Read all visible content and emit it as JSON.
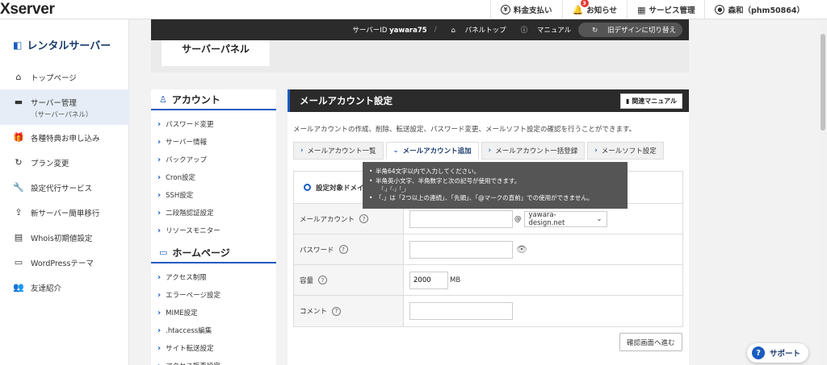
{
  "header": {
    "logo": "Xserver",
    "nav": [
      {
        "icon": "yen-icon",
        "label": "料金支払い"
      },
      {
        "icon": "bell-icon",
        "label": "お知らせ",
        "badge": "3"
      },
      {
        "icon": "grid-icon",
        "label": "サービス管理"
      },
      {
        "icon": "user-icon",
        "label": "森和（phm50864）"
      }
    ]
  },
  "sidebar": {
    "title": "レンタルサーバー",
    "items": [
      {
        "icon": "home-icon",
        "label": "トップページ"
      },
      {
        "icon": "server-icon",
        "label": "サーバー管理",
        "sub": "（サーバーパネル）",
        "active": true
      },
      {
        "icon": "gift-icon",
        "label": "各種特典お申し込み"
      },
      {
        "icon": "refresh-icon",
        "label": "プラン変更"
      },
      {
        "icon": "wrench-icon",
        "label": "設定代行サービス"
      },
      {
        "icon": "upload-icon",
        "label": "新サーバー簡単移行"
      },
      {
        "icon": "doc-icon",
        "label": "Whois初期値設定"
      },
      {
        "icon": "window-icon",
        "label": "WordPressテーマ"
      },
      {
        "icon": "people-icon",
        "label": "友達紹介"
      }
    ]
  },
  "panel": {
    "title": "サーバーパネル",
    "server_id_label": "サーバーID",
    "server_id": "yawara75",
    "panel_top": "パネルトップ",
    "manual": "マニュアル",
    "old_design": "旧デザインに切り替え"
  },
  "submenu": {
    "account_title": "アカウント",
    "account_items": [
      "パスワード変更",
      "サーバー情報",
      "バックアップ",
      "Cron設定",
      "SSH設定",
      "二段階認証設定",
      "リソースモニター"
    ],
    "homepage_title": "ホームページ",
    "homepage_items": [
      "アクセス制限",
      "エラーページ設定",
      "MIME設定",
      ".htaccess編集",
      "サイト転送設定",
      "アクセス拒否設定"
    ]
  },
  "content": {
    "title": "メールアカウント設定",
    "manual_button": "関連マニュアル",
    "description": "メールアカウントの作成、削除、転送設定、パスワード変更、メールソフト設定の確認を行うことができます。",
    "tabs": [
      "メールアカウント一覧",
      "メールアカウント追加",
      "メールアカウント一括登録",
      "メールソフト設定"
    ],
    "active_tab": 1,
    "target_label": "設定対象ドメイ",
    "fields": {
      "account_label": "メールアカウント",
      "account_value": "",
      "at": "@",
      "domain": "yawara-design.net",
      "password_label": "パスワード",
      "password_value": "",
      "capacity_label": "容量",
      "capacity_value": "2000",
      "capacity_unit": "MB",
      "comment_label": "コメント",
      "comment_value": ""
    },
    "confirm_button": "確認画面へ進む"
  },
  "tooltip": {
    "lines": [
      "半角64文字以内で入力してください。",
      "半角英小文字、半角数字と次の記号が使用できます。",
      "「.」「-」「_」",
      "「.」は「2つ以上の連続」、「先頭」、「@マークの直前」での使用ができません。"
    ]
  },
  "support": {
    "label": "サポート"
  }
}
